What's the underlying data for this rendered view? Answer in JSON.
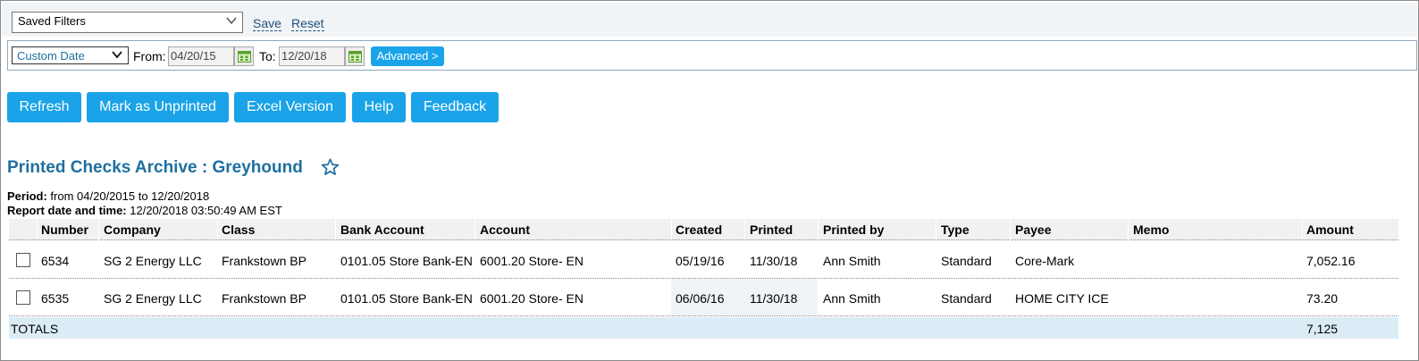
{
  "filters": {
    "saved_filters": "Saved Filters",
    "save": "Save",
    "reset": "Reset",
    "date_range": "Custom Date",
    "from_label": "From:",
    "from_value": "04/20/15",
    "to_label": "To:",
    "to_value": "12/20/18",
    "advanced": "Advanced >"
  },
  "toolbar": {
    "refresh": "Refresh",
    "mark_unprinted": "Mark as Unprinted",
    "excel": "Excel Version",
    "help": "Help",
    "feedback": "Feedback"
  },
  "report": {
    "title": "Printed Checks Archive : Greyhound",
    "period_label": "Period:",
    "period_value": "from 04/20/2015 to 12/20/2018",
    "date_label": "Report date and time:",
    "date_value": "12/20/2018 03:50:49 AM EST"
  },
  "table": {
    "columns": [
      "Number",
      "Company",
      "Class",
      "Bank Account",
      "Account",
      "Created",
      "Printed",
      "Printed by",
      "Type",
      "Payee",
      "Memo",
      "Amount"
    ],
    "rows": [
      [
        "6534",
        "SG 2 Energy LLC",
        "Frankstown BP",
        "0101.05 Store Bank-EN",
        "6001.20 Store- EN",
        "05/19/16",
        "11/30/18",
        "Ann Smith",
        "Standard",
        "Core-Mark",
        "",
        "7,052.16"
      ],
      [
        "6535",
        "SG 2 Energy LLC",
        "Frankstown BP",
        "0101.05 Store Bank-EN",
        "6001.20 Store- EN",
        "06/06/16",
        "11/30/18",
        "Ann Smith",
        "Standard",
        "HOME CITY ICE",
        "",
        "73.20"
      ]
    ],
    "totals_label": "TOTALS",
    "totals_amount": "7,125"
  },
  "colors": {
    "accent": "#1aa3e8",
    "title": "#1f6fa0",
    "header_bg": "#f1f1f1",
    "totals_bg": "#dcecf7"
  },
  "icons": {
    "calendar": "calendar-icon",
    "star": "star-icon",
    "dropdown": "chevron-down-icon"
  }
}
